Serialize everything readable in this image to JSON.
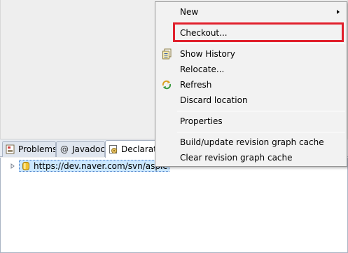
{
  "context_menu": {
    "items": [
      {
        "label": "New",
        "icon": "none",
        "submenu": true
      },
      {
        "label": "Checkout...",
        "icon": "none",
        "highlighted": true
      },
      {
        "label": "Show History",
        "icon": "history-icon"
      },
      {
        "label": "Relocate...",
        "icon": "none"
      },
      {
        "label": "Refresh",
        "icon": "refresh-icon"
      },
      {
        "label": "Discard location",
        "icon": "none"
      },
      {
        "label": "Properties",
        "icon": "none"
      },
      {
        "label": "Build/update revision graph cache",
        "icon": "none"
      },
      {
        "label": "Clear revision graph cache",
        "icon": "none"
      }
    ]
  },
  "tabs": [
    {
      "label": "Problems",
      "icon": "problems-icon"
    },
    {
      "label": "Javadoc",
      "icon": "at-sign-icon"
    },
    {
      "label": "Declarati",
      "icon": "declaration-icon"
    }
  ],
  "tree": {
    "repository_url": "https://dev.naver.com/svn/aspic"
  },
  "colors": {
    "highlight_border": "#e0202c",
    "selection_bg": "#cce8ff",
    "menu_bg": "#f2f2f2"
  }
}
